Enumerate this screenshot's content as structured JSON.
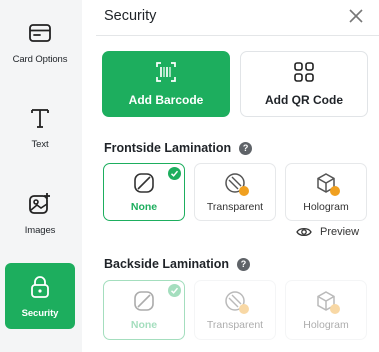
{
  "sidebar": {
    "items": [
      {
        "label": "Card Options",
        "icon": "card-icon",
        "active": false
      },
      {
        "label": "Text",
        "icon": "text-icon",
        "active": false
      },
      {
        "label": "Images",
        "icon": "image-icon",
        "active": false
      },
      {
        "label": "Security",
        "icon": "lock-icon",
        "active": true
      }
    ]
  },
  "panel": {
    "title": "Security",
    "close_icon": "close-icon",
    "add_barcode_label": "Add Barcode",
    "add_qr_label": "Add QR Code",
    "help_glyph": "?"
  },
  "frontside": {
    "heading": "Frontside Lamination",
    "options": [
      {
        "label": "None",
        "selected": true
      },
      {
        "label": "Transparent",
        "selected": false
      },
      {
        "label": "Hologram",
        "selected": false
      }
    ],
    "preview_label": "Preview"
  },
  "backside": {
    "heading": "Backside Lamination",
    "options": [
      {
        "label": "None",
        "selected": true
      },
      {
        "label": "Transparent",
        "selected": false
      },
      {
        "label": "Hologram",
        "selected": false
      }
    ],
    "disabled": true
  },
  "colors": {
    "accent": "#1dae5e",
    "sidebar_bg": "#f4f5f6",
    "lock_badge": "#f0a020"
  }
}
